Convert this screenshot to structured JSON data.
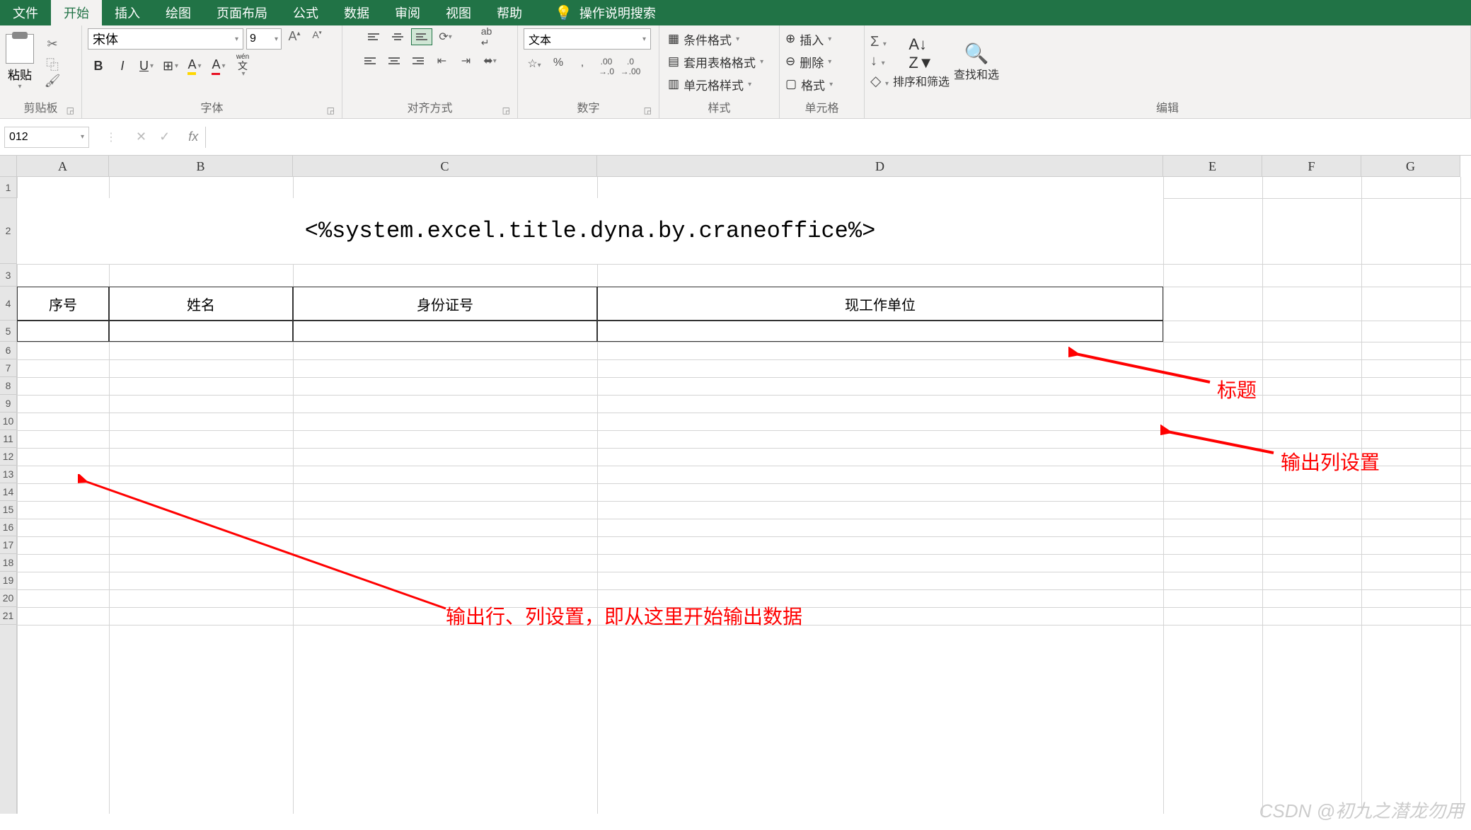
{
  "ribbon": {
    "tabs": [
      "文件",
      "开始",
      "插入",
      "绘图",
      "页面布局",
      "公式",
      "数据",
      "审阅",
      "视图",
      "帮助"
    ],
    "tellme": "操作说明搜索",
    "clipboard": {
      "paste": "粘贴",
      "label": "剪贴板"
    },
    "font": {
      "name": "宋体",
      "size": "9",
      "label": "字体",
      "wen": "wén",
      "wenchar": "文"
    },
    "alignment": {
      "label": "对齐方式"
    },
    "number": {
      "format": "文本",
      "label": "数字"
    },
    "styles": {
      "conditional": "条件格式",
      "table": "套用表格格式",
      "cell": "单元格样式",
      "label": "样式"
    },
    "cells": {
      "insert": "插入",
      "delete": "删除",
      "format": "格式",
      "label": "单元格"
    },
    "editing": {
      "sort": "排序和筛选",
      "find": "查找和选",
      "label": "编辑"
    }
  },
  "formula_bar": {
    "namebox": "012",
    "fx": "fx"
  },
  "columns": [
    "A",
    "B",
    "C",
    "D",
    "E",
    "F",
    "G"
  ],
  "sheet": {
    "title": "<%system.excel.title.dyna.by.craneoffice%>",
    "headers": [
      "序号",
      "姓名",
      "身份证号",
      "现工作单位"
    ]
  },
  "annotations": {
    "title": "标题",
    "col_setting": "输出列设置",
    "row_setting": "输出行、列设置，即从这里开始输出数据"
  },
  "watermark": "CSDN @初九之潜龙勿用"
}
